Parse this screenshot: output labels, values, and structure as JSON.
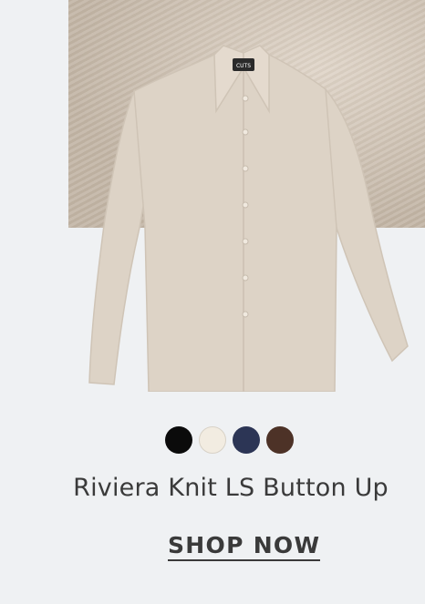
{
  "product": {
    "name": "Riviera Knit LS Button Up",
    "label_text": "CUTS",
    "cta_label": "SHOP NOW"
  },
  "swatches": [
    {
      "name": "black",
      "color": "#0b0b0b"
    },
    {
      "name": "cream",
      "color": "#f2ece1"
    },
    {
      "name": "navy",
      "color": "#2c3555"
    },
    {
      "name": "brown",
      "color": "#4d3227"
    }
  ],
  "colors": {
    "background": "#eff1f3",
    "shirt": "#ddd3c6",
    "text": "#3a3a3a"
  }
}
